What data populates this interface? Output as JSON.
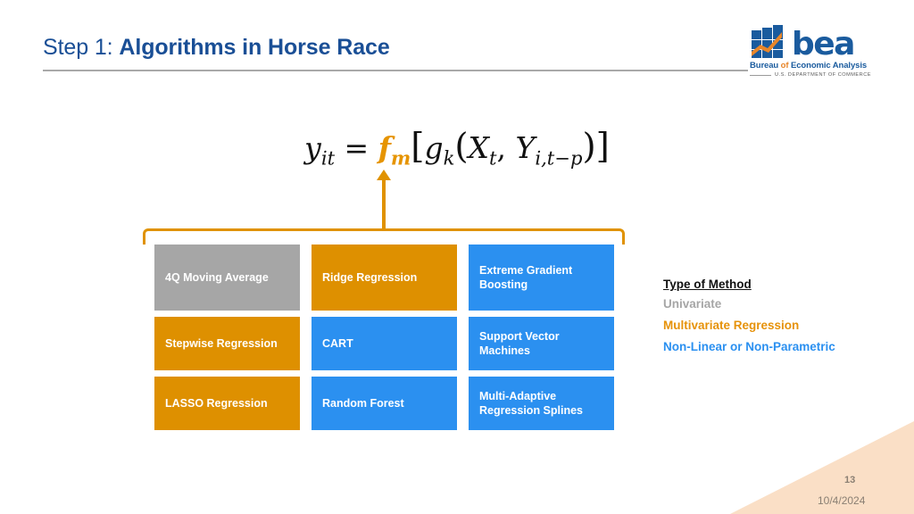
{
  "slide": {
    "title_step": "Step 1:",
    "title_main": "Algorithms in Horse Race"
  },
  "logo": {
    "wordmark": "bea",
    "subtitle_before": "Bureau ",
    "subtitle_of": "of",
    "subtitle_after": " Economic Analysis",
    "department": "U.S. DEPARTMENT OF COMMERCE"
  },
  "equation": {
    "lhs_var": "y",
    "lhs_sub": "it",
    "equals": "=",
    "f_var": "f",
    "f_sub": "m",
    "open_bracket": "[",
    "g_var": "g",
    "g_sub": "k",
    "open_paren": "(",
    "x_var": "X",
    "x_sub": "t",
    "comma": ", ",
    "y_var": "Y",
    "y_sub": "i,t−p",
    "close_paren": ")",
    "close_bracket": "]",
    "full_text": "y_it = f_m[g_k(X_t, Y_i,t-p)]"
  },
  "grid": {
    "rows": [
      [
        {
          "label": "4Q Moving Average",
          "color_class": "c-gray",
          "color": "#a6a6a6"
        },
        {
          "label": "Ridge Regression",
          "color_class": "c-orange",
          "color": "#de9000"
        },
        {
          "label": "Extreme Gradient Boosting",
          "color_class": "c-blue",
          "color": "#2b90f0"
        }
      ],
      [
        {
          "label": "Stepwise Regression",
          "color_class": "c-orange",
          "color": "#de9000"
        },
        {
          "label": "CART",
          "color_class": "c-blue",
          "color": "#2b90f0"
        },
        {
          "label": "Support Vector Machines",
          "color_class": "c-blue",
          "color": "#2b90f0"
        }
      ],
      [
        {
          "label": "LASSO Regression",
          "color_class": "c-orange",
          "color": "#de9000"
        },
        {
          "label": "Random Forest",
          "color_class": "c-blue",
          "color": "#2b90f0"
        },
        {
          "label": "Multi-Adaptive Regression Splines",
          "color_class": "c-blue",
          "color": "#2b90f0"
        }
      ]
    ]
  },
  "legend": {
    "title": "Type of Method",
    "items": [
      {
        "label": "Univariate",
        "color": "#a6a6a6"
      },
      {
        "label": "Multivariate Regression",
        "color": "#e6920a"
      },
      {
        "label": "Non-Linear or Non-Parametric",
        "color": "#2b90f0"
      }
    ]
  },
  "footer": {
    "page_number": "13",
    "date": "10/4/2024"
  },
  "theme": {
    "title_blue": "#1a4f96",
    "accent_orange": "#e09200",
    "accent_blue": "#2b90f0",
    "neutral_gray": "#a6a6a6",
    "corner_peach": "#fadfc6"
  }
}
